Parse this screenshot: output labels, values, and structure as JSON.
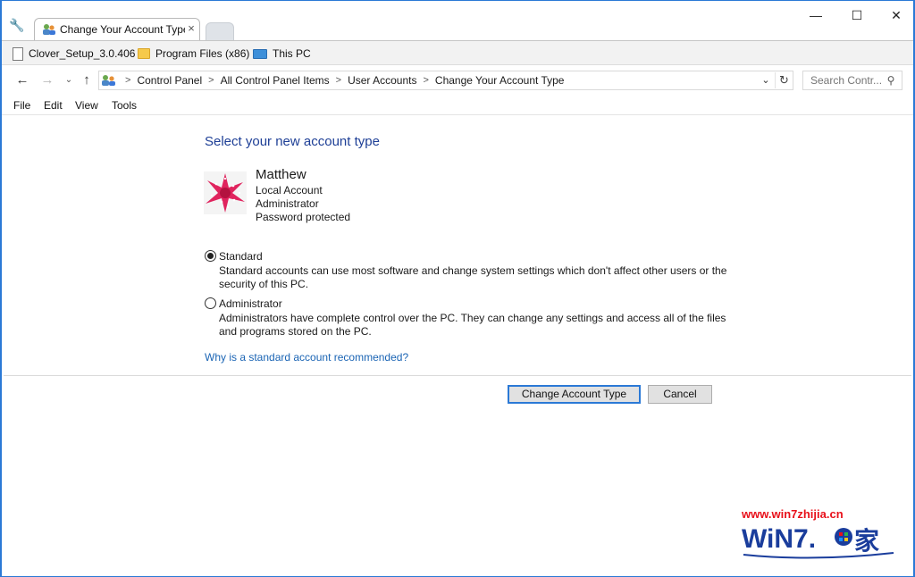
{
  "tab": {
    "title": "Change Your Account Type",
    "close_glyph": "×"
  },
  "window_controls": {
    "minimize": "—",
    "maximize": "☐",
    "close": "✕"
  },
  "bookmarks": [
    {
      "label": "Clover_Setup_3.0.406",
      "icon": "document-icon"
    },
    {
      "label": "Program Files (x86)",
      "icon": "folder-icon"
    },
    {
      "label": "This PC",
      "icon": "computer-icon"
    }
  ],
  "address": {
    "crumbs": [
      "Control Panel",
      "All Control Panel Items",
      "User Accounts",
      "Change Your Account Type"
    ]
  },
  "search": {
    "placeholder": "Search Contr..."
  },
  "menu": [
    "File",
    "Edit",
    "View",
    "Tools"
  ],
  "page": {
    "title": "Select your new account type",
    "user": {
      "name": "Matthew",
      "lines": [
        "Local Account",
        "Administrator",
        "Password protected"
      ]
    },
    "options": [
      {
        "label": "Standard",
        "checked": true,
        "description": "Standard accounts can use most software and change system settings which don't affect other users or the security of this PC."
      },
      {
        "label": "Administrator",
        "checked": false,
        "description": "Administrators have complete control over the PC. They can change any settings and access all of the files and programs stored on the PC."
      }
    ],
    "link": "Why is a standard account recommended?",
    "buttons": {
      "primary": "Change Account Type",
      "cancel": "Cancel"
    }
  },
  "watermark": {
    "url": "www.win7zhijia.cn",
    "logo_text": "WiN7.",
    "logo_char": "家"
  },
  "colors": {
    "accent": "#2b79d6",
    "title_blue": "#1e3f96",
    "link_blue": "#1a64b4",
    "watermark_red": "#e8101a"
  }
}
